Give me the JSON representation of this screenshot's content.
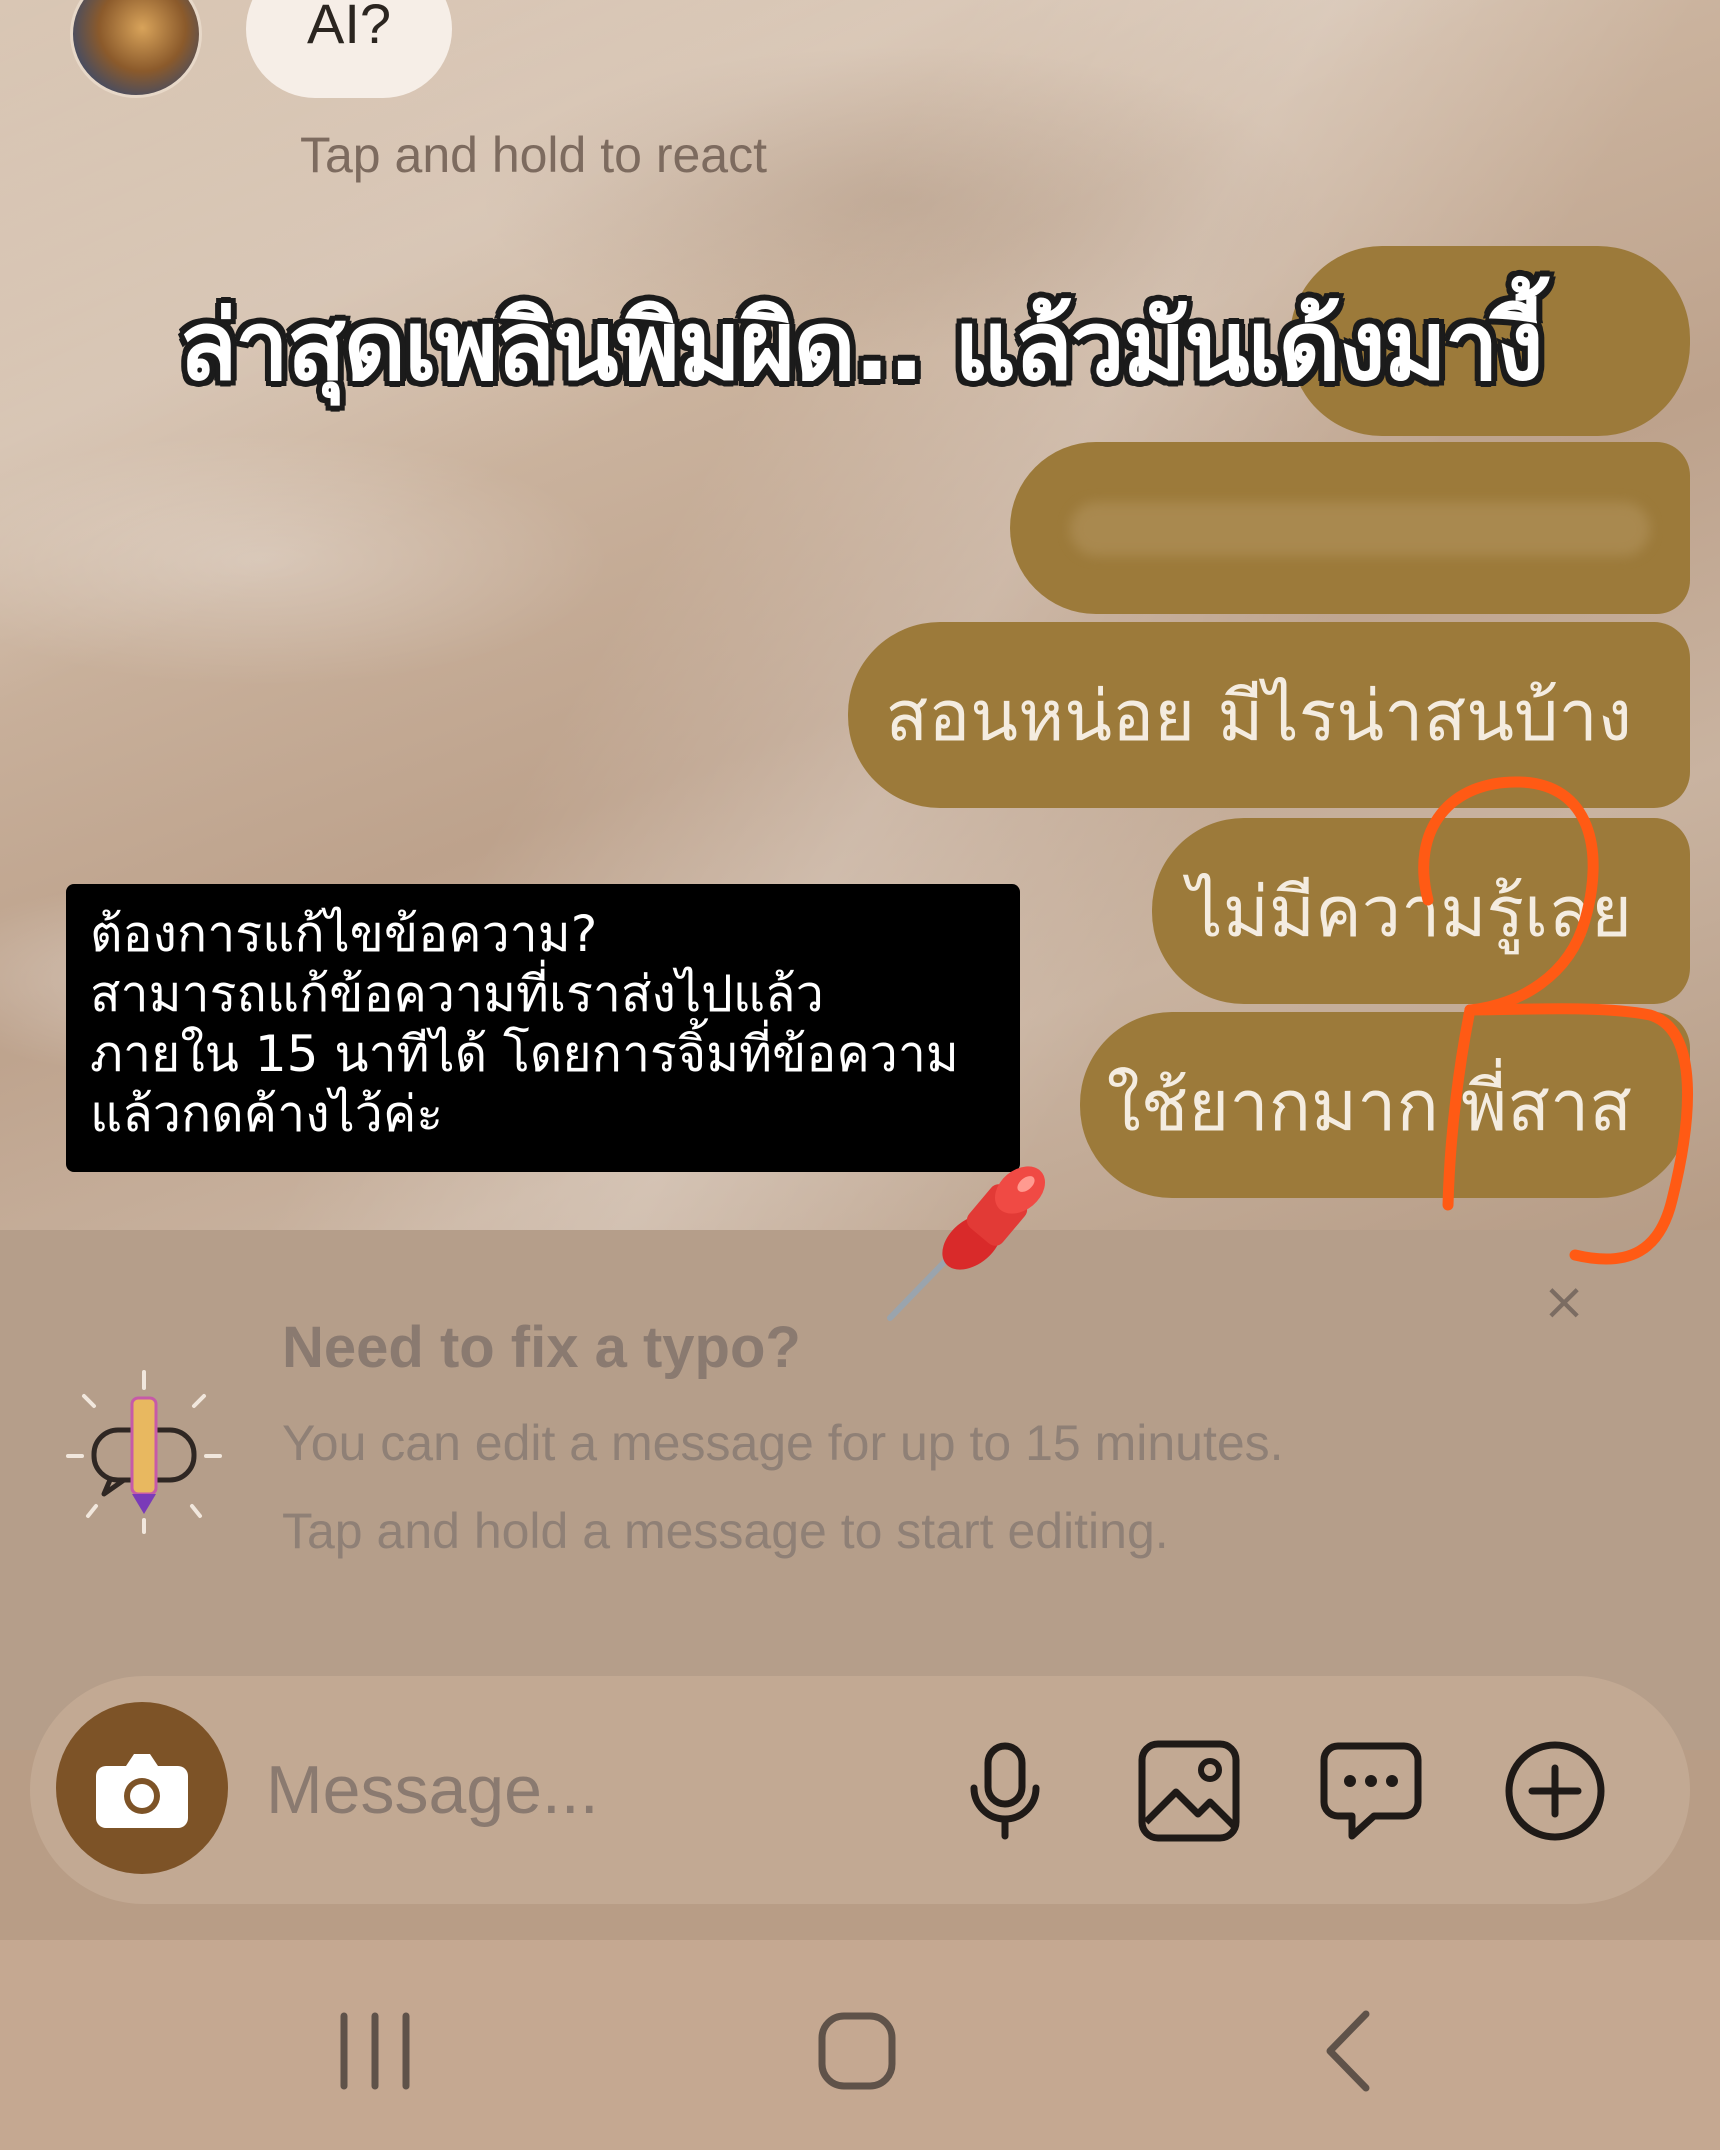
{
  "headline": "ล่าสุดเพลินพิมผิด.. แล้วมันเด้งมางี้",
  "chat": {
    "received_snippet": "AI?",
    "react_hint": "Tap and hold to react",
    "sent_messages": [
      "",
      "",
      "สอนหน่อย มีไรน่าสนบ้าง",
      "ไม่มีความรู้เลย",
      "ใช้ยากมาก พี่สาส"
    ]
  },
  "caption": {
    "lines": [
      "ต้องการแก้ไขข้อความ?",
      "สามารถแก้ข้อความที่เราส่งไปแล้ว",
      "ภายใน 15 นาทีได้ โดยการจิ้มที่ข้อความ",
      "แล้วกดค้างไว้ค่ะ"
    ]
  },
  "tip": {
    "title": "Need to fix a typo?",
    "line1": "You can edit a message for up to 15 minutes.",
    "line2": "Tap and hold a message to start editing.",
    "close": "×"
  },
  "composer": {
    "placeholder": "Message..."
  },
  "icons": {
    "camera": "camera-icon",
    "mic": "microphone-icon",
    "gallery": "image-icon",
    "chat": "chat-bubble-icon",
    "plus": "plus-icon",
    "tip": "edit-bubble-icon",
    "pin": "pushpin-icon"
  },
  "colors": {
    "sent_bubble": "#9c7a3a",
    "camera_button": "#7d5327",
    "marker": "#ff5a14",
    "caption_bg": "#000000"
  }
}
